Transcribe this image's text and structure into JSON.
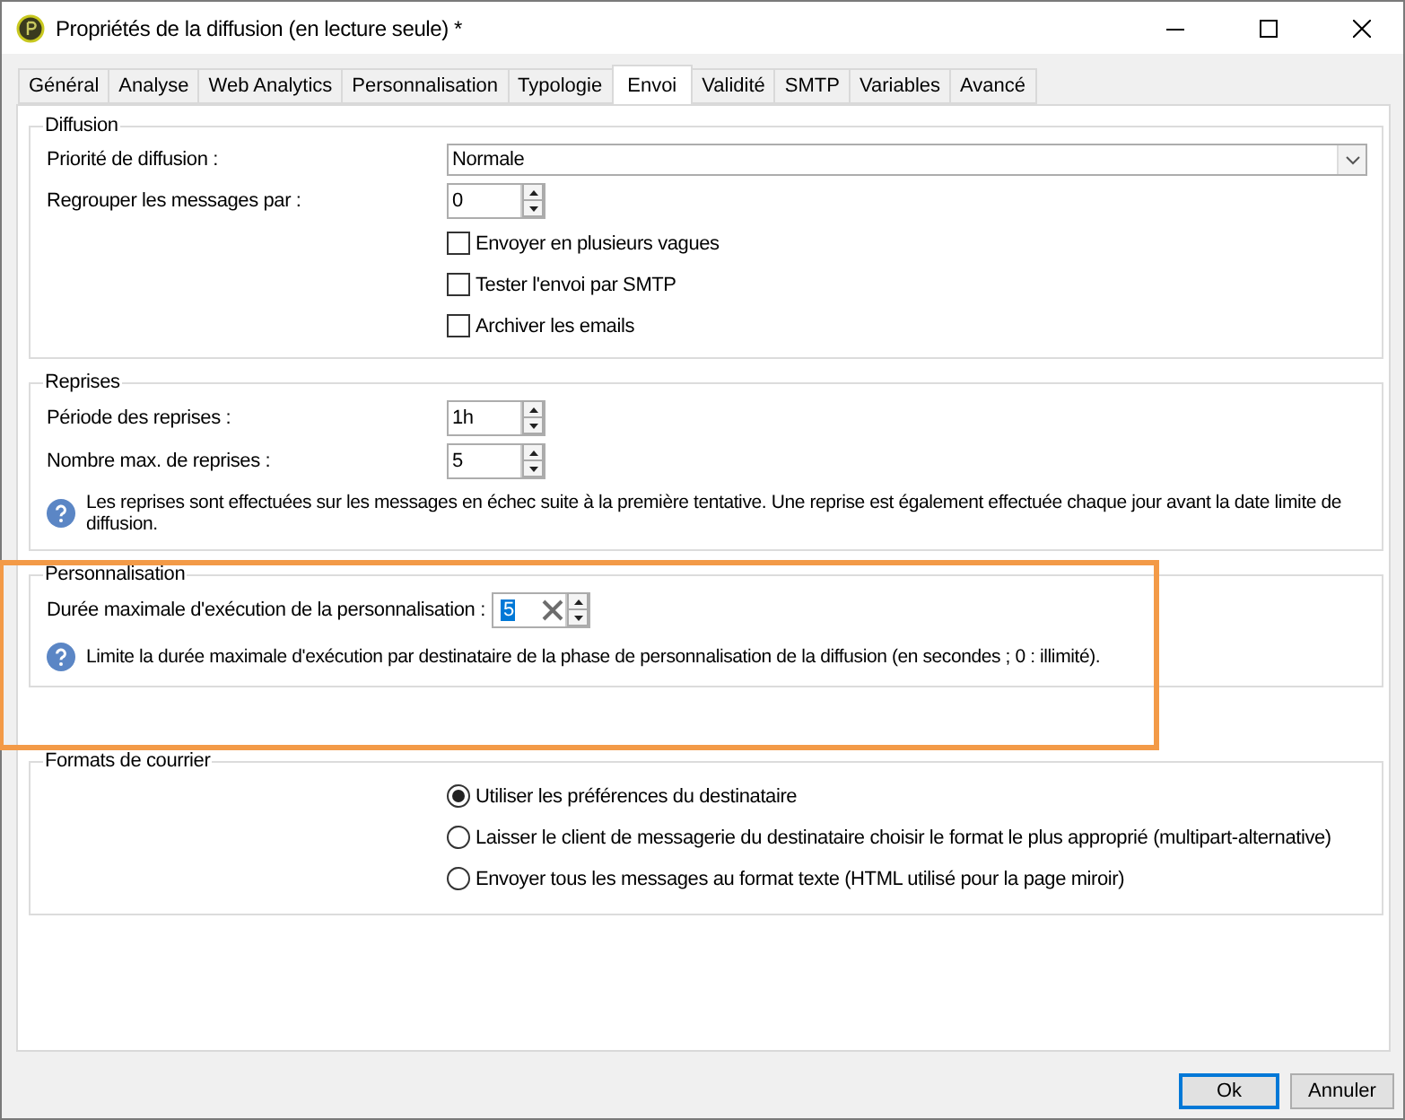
{
  "window": {
    "title": "Propriétés de la diffusion (en lecture seule) *"
  },
  "tabs": [
    {
      "label": "Général",
      "selected": false
    },
    {
      "label": "Analyse",
      "selected": false
    },
    {
      "label": "Web Analytics",
      "selected": false
    },
    {
      "label": "Personnalisation",
      "selected": false
    },
    {
      "label": "Typologie",
      "selected": false
    },
    {
      "label": "Envoi",
      "selected": true
    },
    {
      "label": "Validité",
      "selected": false
    },
    {
      "label": "SMTP",
      "selected": false
    },
    {
      "label": "Variables",
      "selected": false
    },
    {
      "label": "Avancé",
      "selected": false
    }
  ],
  "groups": [
    {
      "title": "Diffusion",
      "highlighted": false,
      "rows": [
        {
          "kind": "select",
          "label": "Priorité de diffusion :",
          "value": "Normale"
        },
        {
          "kind": "spin",
          "label": "Regrouper les messages par :",
          "value": "0",
          "clearable": false,
          "value_selected": false
        },
        {
          "kind": "checkbox",
          "label": "Envoyer en plusieurs vagues",
          "checked": false
        },
        {
          "kind": "checkbox",
          "label": "Tester l'envoi par SMTP",
          "checked": false
        },
        {
          "kind": "checkbox",
          "label": "Archiver les emails",
          "checked": false
        }
      ]
    },
    {
      "title": "Reprises",
      "highlighted": false,
      "rows": [
        {
          "kind": "spin",
          "label": "Période des reprises :",
          "value": "1h",
          "clearable": false,
          "value_selected": false
        },
        {
          "kind": "spin",
          "label": "Nombre max. de reprises :",
          "value": "5",
          "clearable": false,
          "value_selected": false
        },
        {
          "kind": "info",
          "text": "Les reprises sont effectuées sur les messages en échec suite à la première tentative. Une reprise est également effectuée chaque jour avant la date limite de diffusion."
        }
      ]
    },
    {
      "title": "Personnalisation",
      "highlighted": true,
      "rows": [
        {
          "kind": "spin",
          "label": "Durée maximale d'exécution de la personnalisation :",
          "value": "5",
          "clearable": true,
          "value_selected": true
        },
        {
          "kind": "info",
          "text": "Limite la durée maximale d'exécution par destinataire de la phase de personnalisation de la diffusion (en secondes ; 0 : illimité)."
        }
      ]
    },
    {
      "title": "Formats de courrier",
      "highlighted": false,
      "rows": [
        {
          "kind": "radio",
          "label": "Utiliser les préférences du destinataire",
          "selected": true
        },
        {
          "kind": "radio",
          "label": "Laisser le client de messagerie du destinataire choisir le format le plus approprié (multipart-alternative)",
          "selected": false
        },
        {
          "kind": "radio",
          "label": "Envoyer tous les messages au format texte (HTML utilisé pour la page miroir)",
          "selected": false
        }
      ]
    }
  ],
  "buttons": [
    {
      "label": "Ok",
      "default": true
    },
    {
      "label": "Annuler",
      "default": false
    }
  ]
}
